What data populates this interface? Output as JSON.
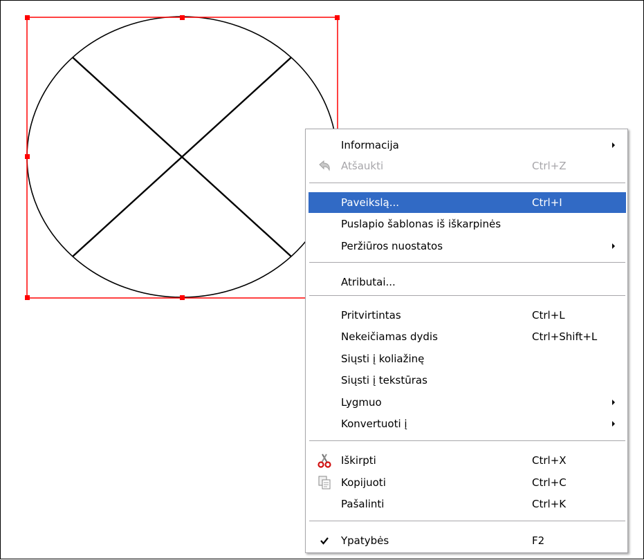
{
  "colors": {
    "selection_border": "#ff0000",
    "shape_stroke": "#000000",
    "menu_highlight": "#316ac5",
    "menu_disabled_text": "#a7a6aa",
    "menu_border": "#a7a6aa"
  },
  "context_menu": {
    "items": [
      {
        "label": "Informacija",
        "shortcut": "",
        "submenu": true
      },
      {
        "label": "Atšaukti",
        "shortcut": "Ctrl+Z",
        "disabled": true,
        "icon": "undo-icon"
      },
      {
        "label": "Paveikslą...",
        "shortcut": "Ctrl+I",
        "selected": true
      },
      {
        "label": "Puslapio šablonas iš iškarpinės",
        "shortcut": ""
      },
      {
        "label": "Peržiūros nuostatos",
        "shortcut": "",
        "submenu": true
      },
      {
        "label": "Atributai...",
        "shortcut": ""
      },
      {
        "label": "Pritvirtintas",
        "shortcut": "Ctrl+L"
      },
      {
        "label": "Nekeičiamas dydis",
        "shortcut": "Ctrl+Shift+L"
      },
      {
        "label": "Siųsti į koliažinę",
        "shortcut": ""
      },
      {
        "label": "Siųsti į tekstūras",
        "shortcut": ""
      },
      {
        "label": "Lygmuo",
        "shortcut": "",
        "submenu": true
      },
      {
        "label": "Konvertuoti į",
        "shortcut": "",
        "submenu": true
      },
      {
        "label": "Iškirpti",
        "shortcut": "Ctrl+X",
        "icon": "scissors-icon"
      },
      {
        "label": "Kopijuoti",
        "shortcut": "Ctrl+C",
        "icon": "copy-icon"
      },
      {
        "label": "Pašalinti",
        "shortcut": "Ctrl+K"
      },
      {
        "label": "Ypatybės",
        "shortcut": "F2",
        "icon": "checkmark-icon"
      }
    ]
  }
}
